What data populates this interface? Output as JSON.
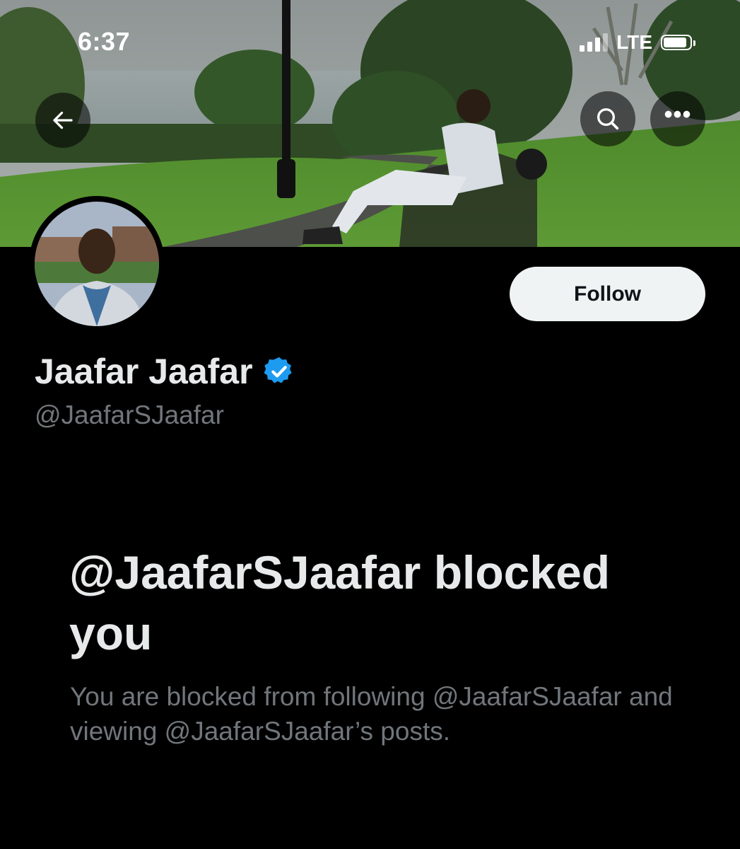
{
  "status_bar": {
    "time": "6:37",
    "network": "LTE",
    "signal_bars_active": 3,
    "signal_bars_total": 4,
    "battery_level_pct": 90
  },
  "header": {
    "back_icon": "arrow-left-icon",
    "search_icon": "search-icon",
    "more_icon": "more-horizontal-icon",
    "more_glyph": "•••"
  },
  "profile": {
    "follow_label": "Follow",
    "display_name": "Jaafar Jaafar",
    "verified_icon": "verified-badge-icon",
    "handle": "@JaafarSJaafar"
  },
  "blocked": {
    "title": "@JaafarSJaafar blocked you",
    "description": "You are blocked from following @JaafarSJaafar and viewing @JaafarSJaafar’s posts."
  },
  "colors": {
    "background": "#000000",
    "text_primary": "#e7e9ea",
    "text_secondary": "#71767b",
    "verified_blue": "#1d9bf0",
    "follow_button_bg": "#eff3f4"
  }
}
